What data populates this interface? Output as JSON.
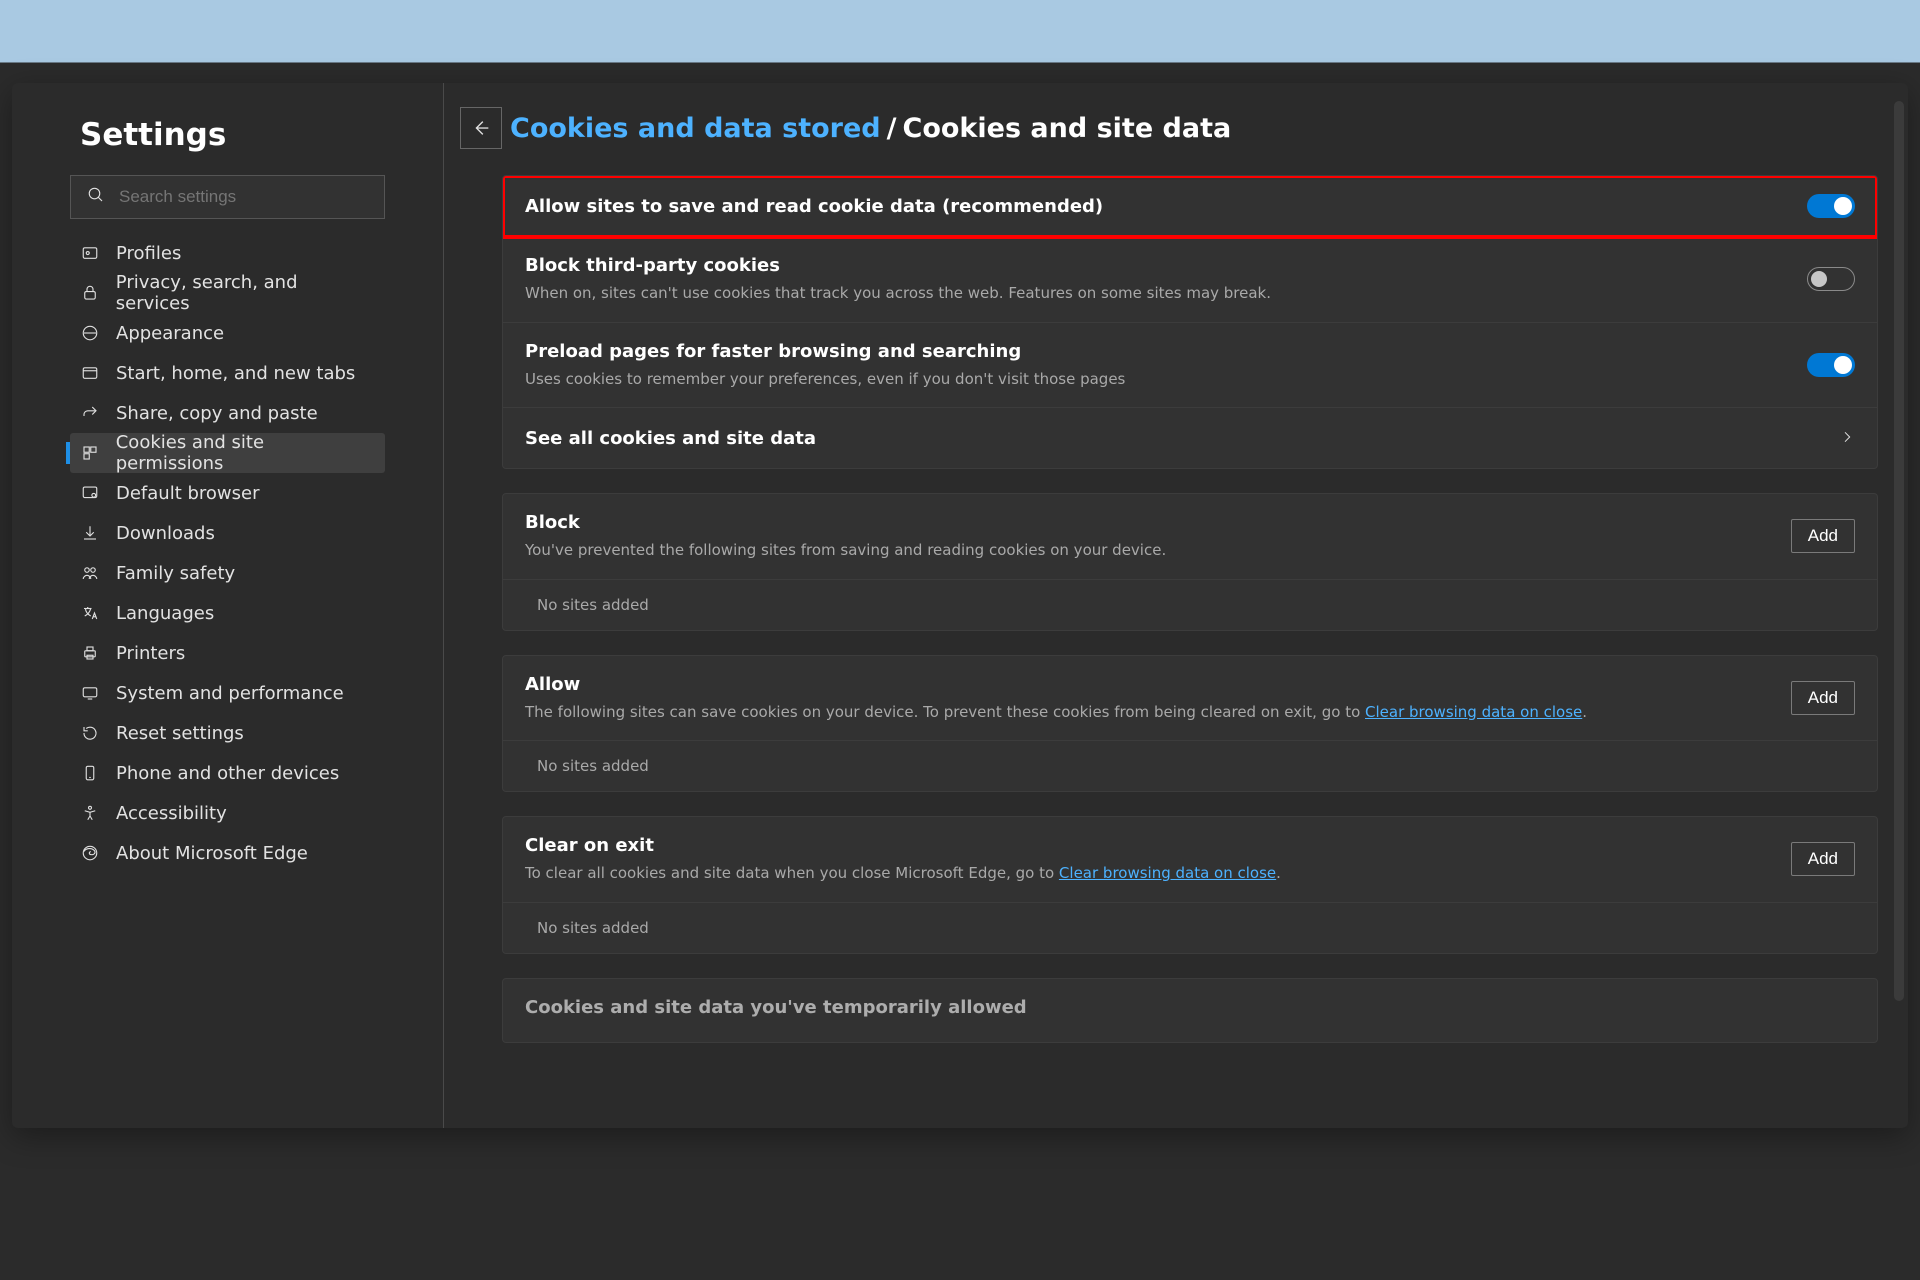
{
  "sidebar": {
    "title": "Settings",
    "search_placeholder": "Search settings",
    "items": [
      {
        "label": "Profiles"
      },
      {
        "label": "Privacy, search, and services"
      },
      {
        "label": "Appearance"
      },
      {
        "label": "Start, home, and new tabs"
      },
      {
        "label": "Share, copy and paste"
      },
      {
        "label": "Cookies and site permissions"
      },
      {
        "label": "Default browser"
      },
      {
        "label": "Downloads"
      },
      {
        "label": "Family safety"
      },
      {
        "label": "Languages"
      },
      {
        "label": "Printers"
      },
      {
        "label": "System and performance"
      },
      {
        "label": "Reset settings"
      },
      {
        "label": "Phone and other devices"
      },
      {
        "label": "Accessibility"
      },
      {
        "label": "About Microsoft Edge"
      }
    ],
    "selected_index": 5
  },
  "breadcrumb": {
    "link": "Cookies and data stored",
    "sep": "/",
    "current": "Cookies and site data"
  },
  "toggles": {
    "allow_cookies": {
      "title": "Allow sites to save and read cookie data (recommended)",
      "on": true
    },
    "block_third": {
      "title": "Block third-party cookies",
      "desc": "When on, sites can't use cookies that track you across the web. Features on some sites may break.",
      "on": false
    },
    "preload": {
      "title": "Preload pages for faster browsing and searching",
      "desc": "Uses cookies to remember your preferences, even if you don't visit those pages",
      "on": true
    },
    "see_all": {
      "title": "See all cookies and site data"
    }
  },
  "block_section": {
    "title": "Block",
    "desc": "You've prevented the following sites from saving and reading cookies on your device.",
    "add": "Add",
    "empty": "No sites added"
  },
  "allow_section": {
    "title": "Allow",
    "desc_pre": "The following sites can save cookies on your device. To prevent these cookies from being cleared on exit, go to ",
    "desc_link": "Clear browsing data on close",
    "desc_post": ".",
    "add": "Add",
    "empty": "No sites added"
  },
  "clear_section": {
    "title": "Clear on exit",
    "desc_pre": "To clear all cookies and site data when you close Microsoft Edge, go to ",
    "desc_link": "Clear browsing data on close",
    "desc_post": ".",
    "add": "Add",
    "empty": "No sites added"
  },
  "bottom_cut": {
    "title": "Cookies and site data you've temporarily allowed"
  }
}
